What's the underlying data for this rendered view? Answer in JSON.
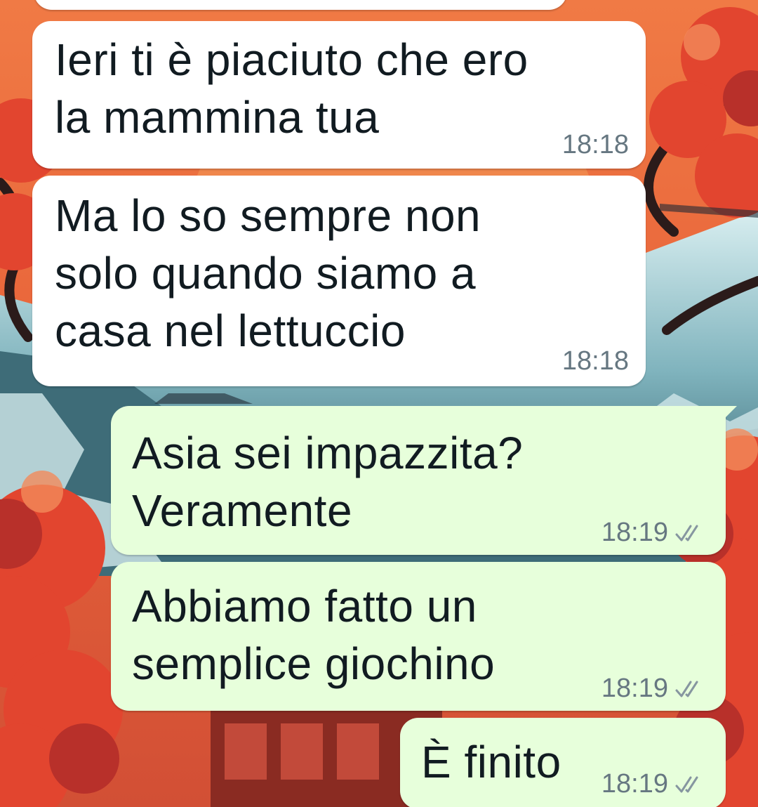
{
  "colors": {
    "incoming_bubble": "#ffffff",
    "outgoing_bubble": "#e7ffdb",
    "timestamp": "#667781",
    "text": "#111b21"
  },
  "messages": [
    {
      "direction": "incoming",
      "text": "Ieri ti è piaciuto che ero\nla mammina tua",
      "time": "18:18"
    },
    {
      "direction": "incoming",
      "text": "Ma lo so sempre non\nsolo quando siamo a\ncasa nel lettuccio",
      "time": "18:18"
    },
    {
      "direction": "outgoing",
      "text": "Asia sei impazzita?\nVeramente",
      "time": "18:19",
      "status_icon": "double-check-icon"
    },
    {
      "direction": "outgoing",
      "text": "Abbiamo fatto un\nsemplice giochino",
      "time": "18:19",
      "status_icon": "double-check-icon"
    },
    {
      "direction": "outgoing",
      "text": "È finito",
      "time": "18:19",
      "status_icon": "double-check-icon"
    }
  ]
}
